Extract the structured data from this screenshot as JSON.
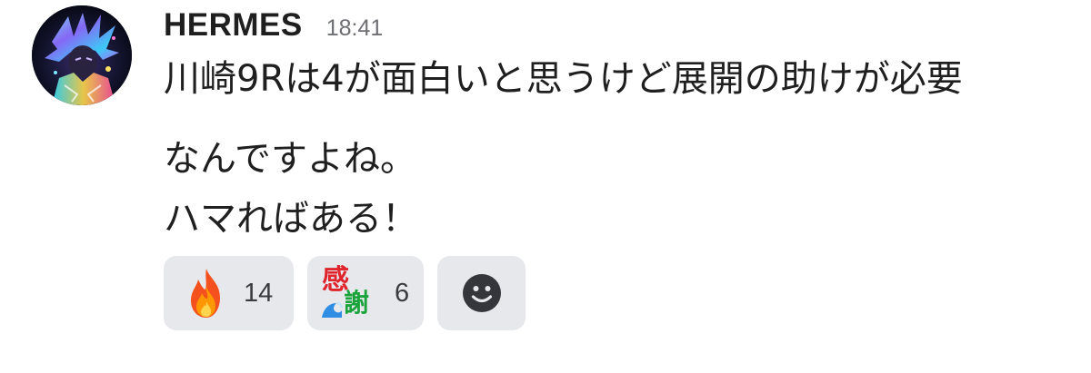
{
  "message": {
    "username": "HERMES",
    "timestamp": "18:41",
    "lines": [
      "川崎9Rは4が面白いと思うけど展開の助けが必要",
      "なんですよね。",
      "ハマればある！"
    ]
  },
  "reactions": [
    {
      "emoji": "fire-emoji",
      "count": "14"
    },
    {
      "emoji": "kansha-emoji",
      "text": [
        "感",
        "謝"
      ],
      "count": "6"
    },
    {
      "emoji": "add-reaction-icon"
    }
  ],
  "colors": {
    "reaction_bg": "#e7e8ec",
    "timestamp": "#6e6f73",
    "text": "#1f1f1f"
  }
}
